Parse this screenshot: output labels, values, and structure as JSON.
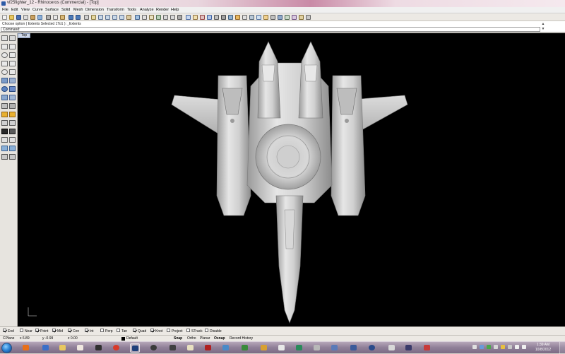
{
  "window": {
    "title": "vf25fighter_12 - Rhinoceros (Commercial) - [Top]"
  },
  "menu": [
    "File",
    "Edit",
    "View",
    "Curve",
    "Surface",
    "Solid",
    "Mesh",
    "Dimension",
    "Transform",
    "Tools",
    "Analyze",
    "Render",
    "Help"
  ],
  "command": {
    "history": "Choose option ( Extents  Selected  1To1 ): _Extents",
    "prompt": "Command:"
  },
  "viewport": {
    "name": "Top",
    "background": "#000000"
  },
  "osnap": [
    {
      "label": "End",
      "checked": true
    },
    {
      "label": "Near",
      "checked": false
    },
    {
      "label": "Point",
      "checked": true
    },
    {
      "label": "Mid",
      "checked": true
    },
    {
      "label": "Cen",
      "checked": true
    },
    {
      "label": "Int",
      "checked": true
    },
    {
      "label": "Perp",
      "checked": false
    },
    {
      "label": "Tan",
      "checked": false
    },
    {
      "label": "Quad",
      "checked": true
    },
    {
      "label": "Knot",
      "checked": true
    },
    {
      "label": "Project",
      "checked": false
    },
    {
      "label": "STrack",
      "checked": false
    },
    {
      "label": "Disable",
      "checked": false
    }
  ],
  "status": {
    "cplane": "CPlane",
    "x": "x 6.89",
    "y": "y -0.99",
    "z": "z 0.00",
    "layer": "Default",
    "toggles": [
      "Snap",
      "Ortho",
      "Planar",
      "Osnap",
      "Record History"
    ]
  },
  "taskbar": {
    "time": "1:39 AM",
    "date": "10/8/2012"
  },
  "colors": {
    "accent": "#2d5aa6",
    "model": "#c9c9c9",
    "toolbar": "#ece9e4"
  }
}
